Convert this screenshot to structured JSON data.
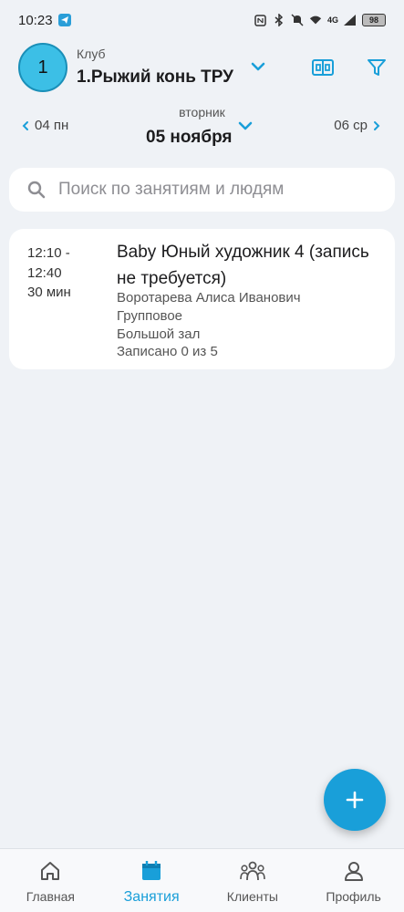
{
  "status_bar": {
    "time": "10:23",
    "battery": "98",
    "network": "4G"
  },
  "header": {
    "club_caption": "Клуб",
    "club_name": "1.Рыжий конь ТРУ",
    "club_avatar_text": "1"
  },
  "date_nav": {
    "prev": "04 пн",
    "weekday": "вторник",
    "current": "05 ноября",
    "next": "06 ср"
  },
  "search": {
    "placeholder": "Поиск по занятиям и людям",
    "value": ""
  },
  "lessons": [
    {
      "time": "12:10 - 12:40",
      "duration": "30 мин",
      "title": "Baby Юный художник 4 (запись не требуется)",
      "trainer": "Воротарева Алиса Иванович",
      "type": "Групповое",
      "room": "Большой зал",
      "enrolled": "Записано 0 из 5"
    }
  ],
  "bottom_nav": [
    {
      "label": "Главная",
      "icon": "home-icon",
      "active": false
    },
    {
      "label": "Занятия",
      "icon": "calendar-icon",
      "active": true
    },
    {
      "label": "Клиенты",
      "icon": "people-icon",
      "active": false
    },
    {
      "label": "Профиль",
      "icon": "person-icon",
      "active": false
    }
  ],
  "colors": {
    "accent": "#199fd9",
    "avatar": "#3cbfe6",
    "background": "#eff2f6"
  }
}
